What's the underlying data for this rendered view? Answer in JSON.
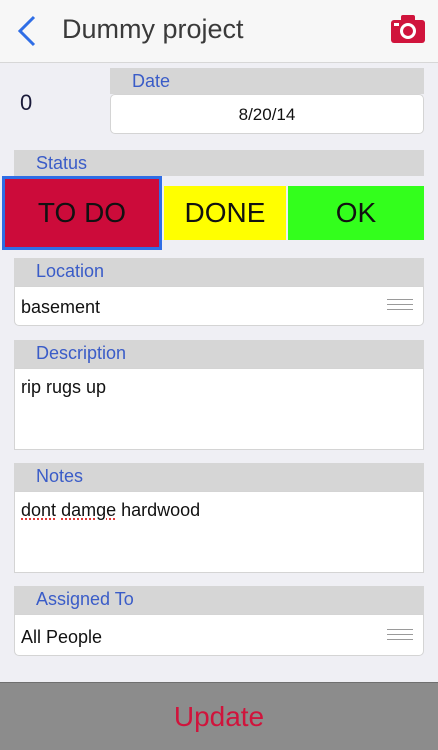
{
  "nav": {
    "title": "Dummy project",
    "back_icon": "chevron-left-icon",
    "camera_icon": "camera-icon"
  },
  "count": "0",
  "date": {
    "label": "Date",
    "value": "8/20/14"
  },
  "status": {
    "label": "Status",
    "options": [
      "TO DO",
      "DONE",
      "OK"
    ],
    "selected": "TO DO",
    "colors": {
      "todo": "#cc0b3a",
      "done": "#ffff00",
      "ok": "#33ff1c"
    }
  },
  "location": {
    "label": "Location",
    "value": "basement"
  },
  "description": {
    "label": "Description",
    "value": "rip rugs up"
  },
  "notes": {
    "label": "Notes",
    "value_words": [
      "dont",
      "damge",
      "hardwood"
    ]
  },
  "assigned": {
    "label": "Assigned To",
    "value": "All People"
  },
  "update_label": "Update",
  "accent": "#3a5cc8"
}
